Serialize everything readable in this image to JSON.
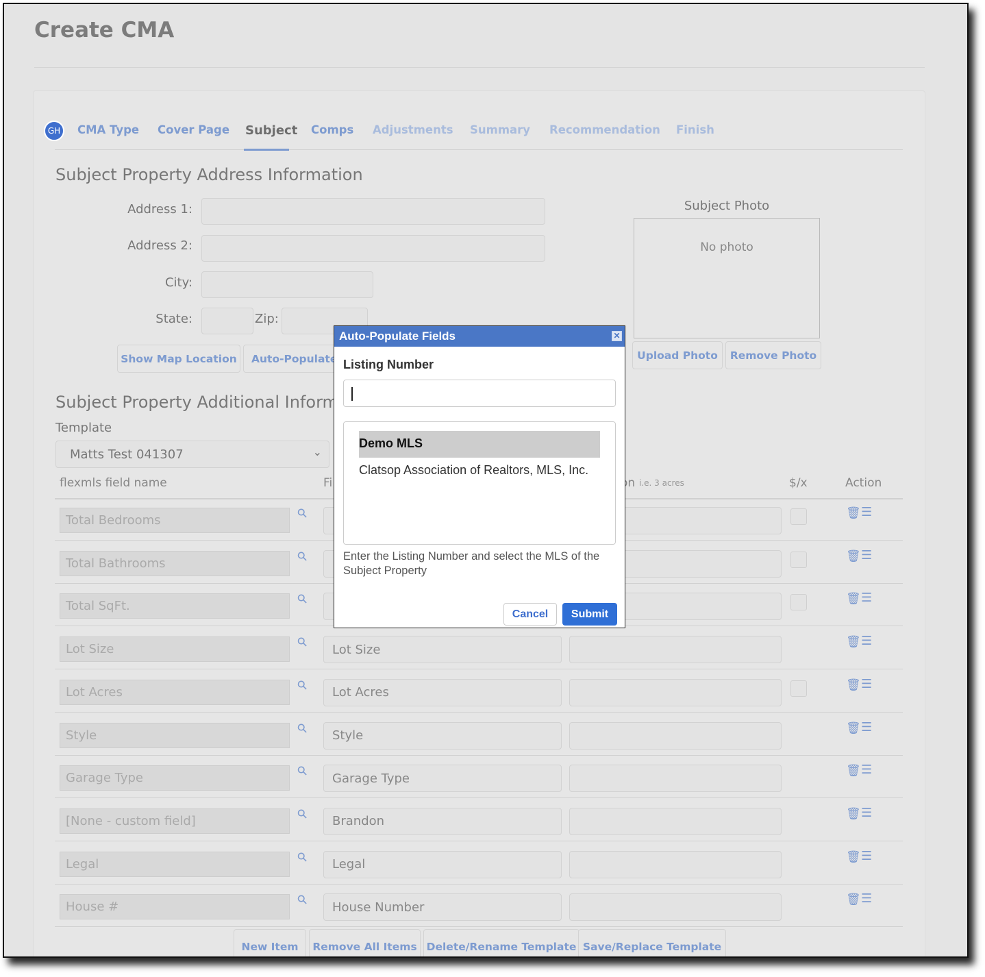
{
  "page_title": "Create CMA",
  "avatar": "GH",
  "tabs": [
    {
      "label": "CMA Type",
      "state": "done"
    },
    {
      "label": "Cover Page",
      "state": "done"
    },
    {
      "label": "Subject",
      "state": "active"
    },
    {
      "label": "Comps",
      "state": "done"
    },
    {
      "label": "Adjustments",
      "state": "pending"
    },
    {
      "label": "Summary",
      "state": "pending"
    },
    {
      "label": "Recommendation",
      "state": "pending"
    },
    {
      "label": "Finish",
      "state": "pending"
    }
  ],
  "address_section": {
    "heading": "Subject Property Address Information",
    "address1_label": "Address 1:",
    "address2_label": "Address 2:",
    "city_label": "City:",
    "state_label": "State:",
    "zip_label": "Zip:",
    "show_map": "Show Map Location",
    "auto_populate": "Auto-Populate"
  },
  "photo": {
    "label": "Subject Photo",
    "empty": "No photo",
    "upload": "Upload Photo",
    "remove": "Remove Photo"
  },
  "additional": {
    "heading": "Subject Property Additional Inform",
    "template_label": "Template",
    "template_value": "Matts Test 041307",
    "col_field": "flexmls field name",
    "col_fi": "Fi",
    "col_on": "on",
    "col_hint": "i.e. 3 acres",
    "col_price": "$/x",
    "col_action": "Action"
  },
  "rows": [
    {
      "flexmls": "Total Bedrooms",
      "field": "",
      "checkbox": true
    },
    {
      "flexmls": "Total Bathrooms",
      "field": "",
      "checkbox": true
    },
    {
      "flexmls": "Total SqFt.",
      "field": "",
      "checkbox": true
    },
    {
      "flexmls": "Lot Size",
      "field": "Lot Size",
      "checkbox": false
    },
    {
      "flexmls": "Lot Acres",
      "field": "Lot Acres",
      "checkbox": true
    },
    {
      "flexmls": "Style",
      "field": "Style",
      "checkbox": false
    },
    {
      "flexmls": "Garage Type",
      "field": "Garage Type",
      "checkbox": false
    },
    {
      "flexmls": "[None - custom field]",
      "field": "Brandon",
      "checkbox": false
    },
    {
      "flexmls": "Legal",
      "field": "Legal",
      "checkbox": false
    },
    {
      "flexmls": "House #",
      "field": "House Number",
      "checkbox": false
    }
  ],
  "bottom_buttons": [
    "New Item",
    "Remove All Items",
    "Delete/Rename Template",
    "Save/Replace Template"
  ],
  "modal": {
    "title": "Auto-Populate Fields",
    "listing_label": "Listing Number",
    "listing_value": "",
    "mls_options": [
      "Demo MLS",
      "Clatsop Association of Realtors, MLS, Inc."
    ],
    "selected_mls": "Demo MLS",
    "help": "Enter the Listing Number and select the MLS of the Subject Property",
    "cancel": "Cancel",
    "submit": "Submit"
  }
}
